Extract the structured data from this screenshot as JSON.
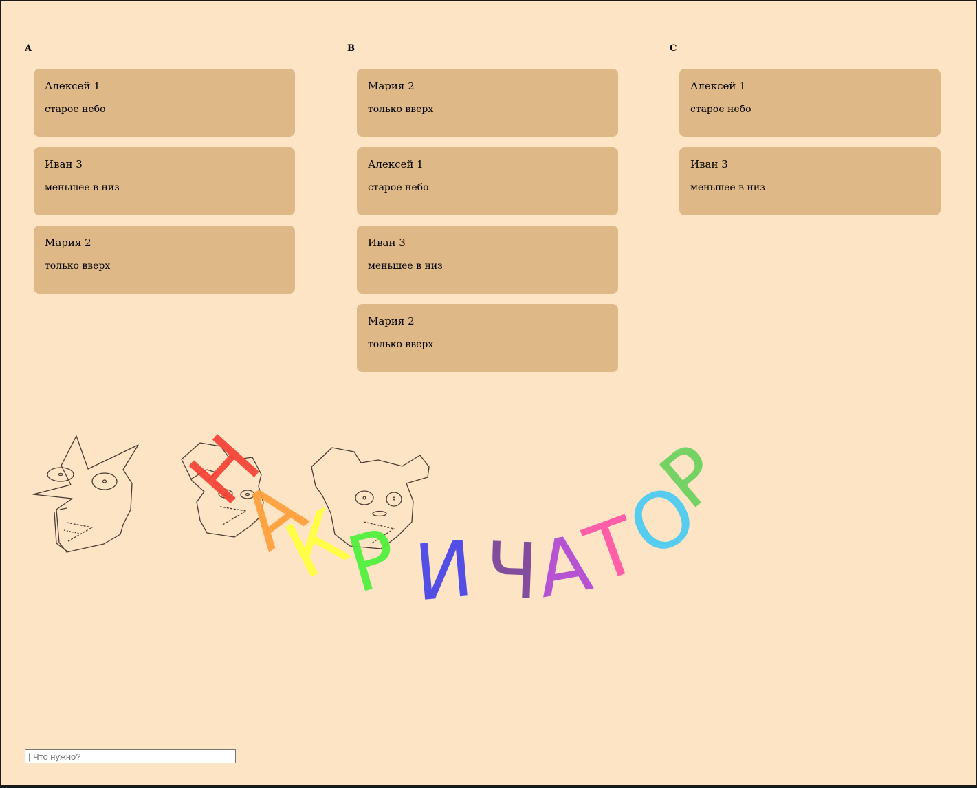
{
  "columns": [
    {
      "heading": "A",
      "cards": [
        {
          "name": "Алексей 1",
          "text": "старое небо"
        },
        {
          "name": "Иван 3",
          "text": "меньшее в низ"
        },
        {
          "name": "Мария 2",
          "text": "только вверх"
        }
      ]
    },
    {
      "heading": "B",
      "cards": [
        {
          "name": "Мария 2",
          "text": "только вверх"
        },
        {
          "name": "Алексей 1",
          "text": "старое небо"
        },
        {
          "name": "Иван 3",
          "text": "меньшее в низ"
        },
        {
          "name": "Мария 2",
          "text": "только вверх"
        }
      ]
    },
    {
      "heading": "C",
      "cards": [
        {
          "name": "Алексей 1",
          "text": "старое небо"
        },
        {
          "name": "Иван 3",
          "text": "меньшее в низ"
        }
      ]
    }
  ],
  "banner": {
    "letters": [
      "Н",
      "А",
      "К",
      "Р",
      "И",
      "Ч",
      "А",
      "Т",
      "О",
      "Р"
    ],
    "colors": [
      "#f44336",
      "#ff9f3a",
      "#ffff3b",
      "#4cf03b",
      "#4a46e8",
      "#7a449a",
      "#b14bd4",
      "#ff56a8",
      "#4dcaf0",
      "#6ed160"
    ]
  },
  "search": {
    "placeholder": "| Что нужно?"
  },
  "colors": {
    "background": "#fde4c4",
    "card": "#deb887"
  }
}
